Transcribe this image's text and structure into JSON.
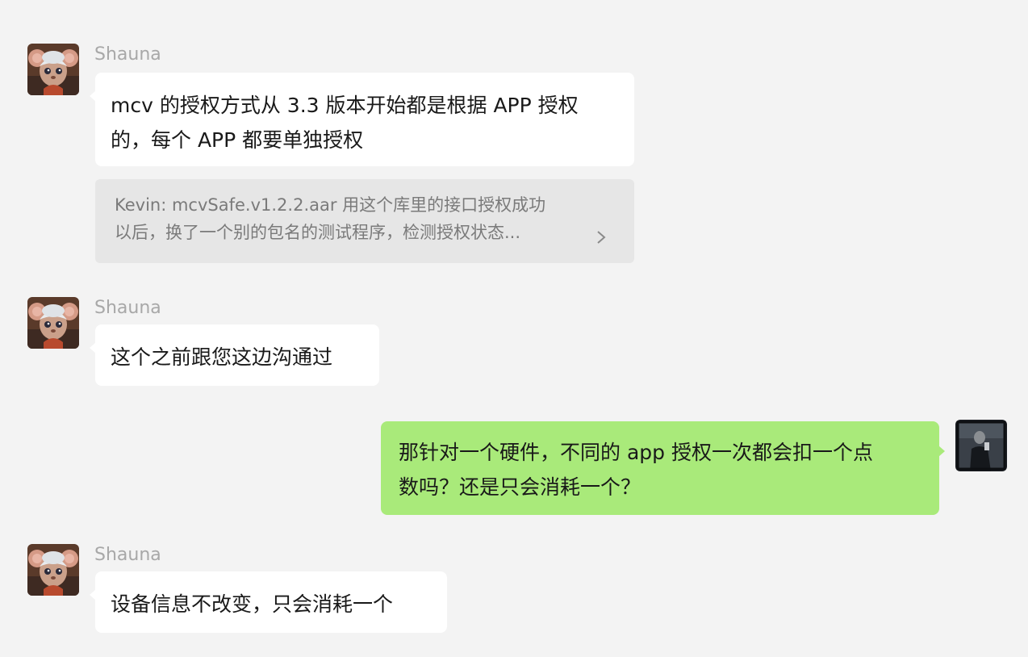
{
  "messages": [
    {
      "sender": "Shauna",
      "lines": [
        "mcv 的授权方式从 3.3 版本开始都是根据 APP 授权",
        "的，每个 APP 都要单独授权"
      ]
    },
    {
      "quote_lines": [
        "Kevin: mcvSafe.v1.2.2.aar 用这个库里的接口授权成功",
        "以后，换了一个别的包名的测试程序，检测授权状态..."
      ]
    },
    {
      "sender": "Shauna",
      "lines": [
        "这个之前跟您这边沟通过"
      ]
    },
    {
      "lines": [
        "那针对一个硬件，不同的 app 授权一次都会扣一个点",
        "数吗？还是只会消耗一个？"
      ]
    },
    {
      "sender": "Shauna",
      "lines": [
        "设备信息不改变，只会消耗一个"
      ]
    }
  ],
  "colors": {
    "background": "#f3f3f3",
    "incoming_bubble": "#ffffff",
    "outgoing_bubble": "#a9ea7a",
    "quote_bubble": "#e6e6e6",
    "sender_name": "#a8a8a8"
  },
  "icons": {
    "contact_avatar": "mouse-character-avatar",
    "self_avatar": "person-photo-avatar",
    "quote_more": "chevron-right-icon"
  }
}
